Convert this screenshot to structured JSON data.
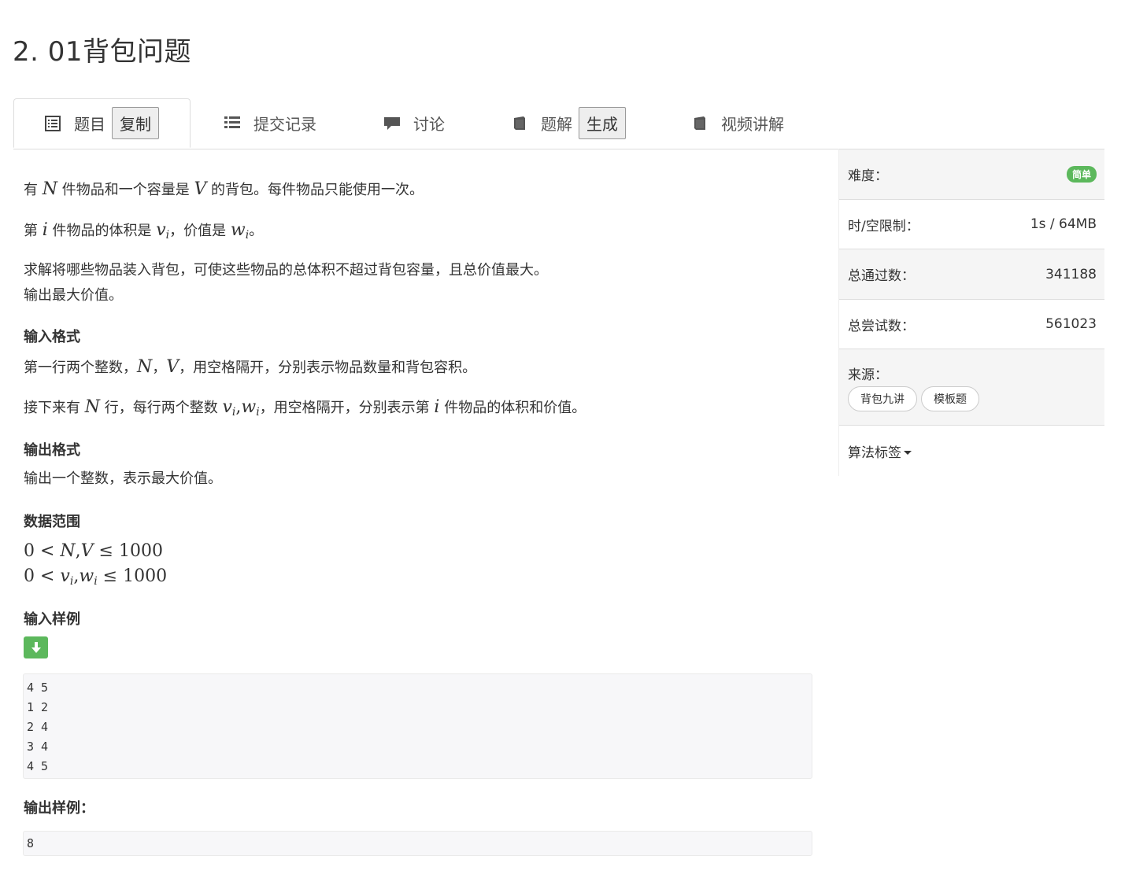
{
  "problem": {
    "title": "2. 01背包问题"
  },
  "tabs": [
    {
      "label": "题目",
      "button": "复制"
    },
    {
      "label": "提交记录"
    },
    {
      "label": "讨论"
    },
    {
      "label": "题解",
      "button": "生成"
    },
    {
      "label": "视频讲解"
    }
  ],
  "desc": {
    "p1_a": "有 ",
    "p1_N": "N",
    "p1_b": " 件物品和一个容量是 ",
    "p1_V": "V",
    "p1_c": " 的背包。每件物品只能使用一次。",
    "p2_a": "第 ",
    "p2_i": "i",
    "p2_b": " 件物品的体积是 ",
    "p2_v": "v",
    "p2_vi": "i",
    "p2_c": "，价值是 ",
    "p2_w": "w",
    "p2_wi": "i",
    "p2_d": "。",
    "p3_line1": "求解将哪些物品装入背包，可使这些物品的总体积不超过背包容量，且总价值最大。",
    "p3_line2": "输出最大价值。"
  },
  "input_format": {
    "heading": "输入格式",
    "l1_a": "第一行两个整数，",
    "l1_N": "N",
    "l1_sep": "，",
    "l1_V": "V",
    "l1_b": "，用空格隔开，分别表示物品数量和背包容积。",
    "l2_a": "接下来有 ",
    "l2_N": "N",
    "l2_b": " 行，每行两个整数 ",
    "l2_v": "v",
    "l2_vi": "i",
    "l2_comma": ",",
    "l2_w": "w",
    "l2_wi": "i",
    "l2_c": "，用空格隔开，分别表示第 ",
    "l2_i": "i",
    "l2_d": " 件物品的体积和价值。"
  },
  "output_format": {
    "heading": "输出格式",
    "text": "输出一个整数，表示最大价值。"
  },
  "data_range": {
    "heading": "数据范围",
    "r1_zero": "0",
    "r1_lt": " < ",
    "r1_N": "N",
    "r1_comma": ",",
    "r1_V": "V",
    "r1_le": " ≤ ",
    "r1_max": "1000",
    "r2_zero": "0",
    "r2_lt": " < ",
    "r2_v": "v",
    "r2_vi": "i",
    "r2_comma": ",",
    "r2_w": "w",
    "r2_wi": "i",
    "r2_le": " ≤ ",
    "r2_max": "1000"
  },
  "sample_input": {
    "heading": "输入样例",
    "lines": [
      "4 5",
      "1 2",
      "2 4",
      "3 4",
      "4 5"
    ]
  },
  "sample_output": {
    "heading": "输出样例：",
    "lines": [
      "8"
    ]
  },
  "sidebar": {
    "difficulty_label": "难度：",
    "difficulty_value": "简单",
    "difficulty_color": "#5cb85c",
    "limit_label": "时/空限制：",
    "limit_value": "1s / 64MB",
    "passed_label": "总通过数：",
    "passed_value": "341188",
    "attempts_label": "总尝试数：",
    "attempts_value": "561023",
    "source_label": "来源：",
    "source_tags": [
      "背包九讲",
      "模板题"
    ],
    "algo_label": "算法标签"
  }
}
